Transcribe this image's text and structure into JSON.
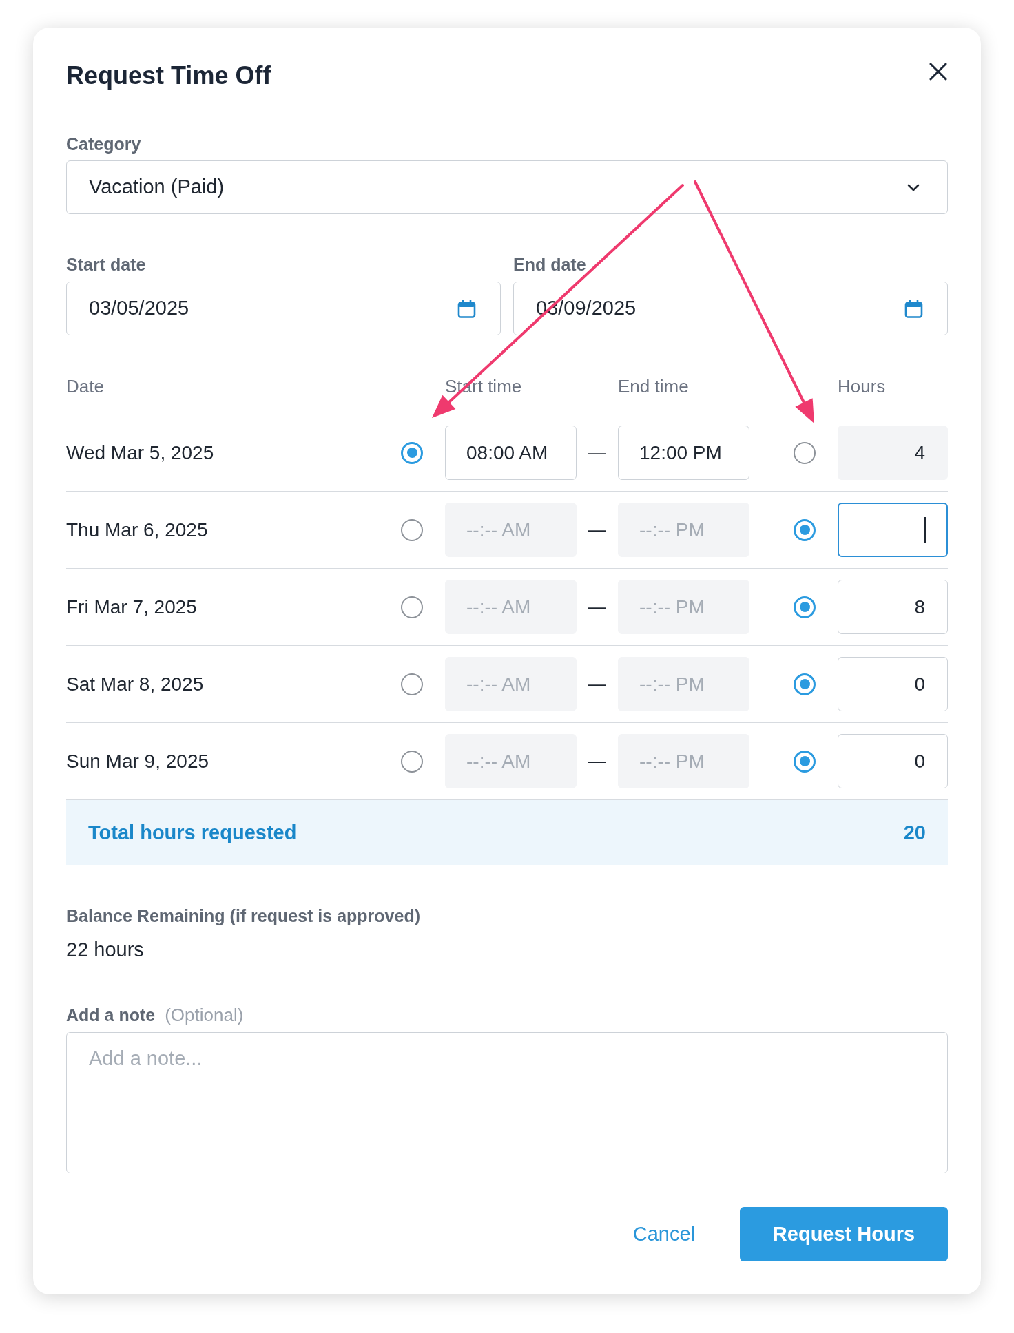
{
  "dialog": {
    "title": "Request Time Off"
  },
  "category": {
    "label": "Category",
    "value": "Vacation (Paid)"
  },
  "start_date": {
    "label": "Start date",
    "value": "03/05/2025"
  },
  "end_date": {
    "label": "End date",
    "value": "03/09/2025"
  },
  "table": {
    "columns": [
      "Date",
      "Start time",
      "End time",
      "Hours"
    ],
    "rows": [
      {
        "date": "Wed Mar 5, 2025",
        "time_option": {
          "selected": true
        },
        "start_time": {
          "value": "08:00 AM",
          "disabled": false
        },
        "separator": "—",
        "end_time": {
          "value": "12:00 PM",
          "disabled": false
        },
        "hours_option": {
          "selected": false
        },
        "hours": {
          "value": "4",
          "disabled": true,
          "focused": false
        }
      },
      {
        "date": "Thu Mar 6, 2025",
        "time_option": {
          "selected": false
        },
        "start_time": {
          "placeholder": "--:-- AM",
          "disabled": true
        },
        "separator": "—",
        "end_time": {
          "placeholder": "--:-- PM",
          "disabled": true
        },
        "hours_option": {
          "selected": true
        },
        "hours": {
          "disabled": false,
          "focused": true
        }
      },
      {
        "date": "Fri Mar 7, 2025",
        "time_option": {
          "selected": false
        },
        "start_time": {
          "placeholder": "--:-- AM",
          "disabled": true
        },
        "separator": "—",
        "end_time": {
          "placeholder": "--:-- PM",
          "disabled": true
        },
        "hours_option": {
          "selected": true
        },
        "hours": {
          "value": "8",
          "disabled": false,
          "focused": false
        }
      },
      {
        "date": "Sat Mar 8, 2025",
        "time_option": {
          "selected": false
        },
        "start_time": {
          "placeholder": "--:-- AM",
          "disabled": true
        },
        "separator": "—",
        "end_time": {
          "placeholder": "--:-- PM",
          "disabled": true
        },
        "hours_option": {
          "selected": true
        },
        "hours": {
          "value": "0",
          "disabled": false,
          "focused": false
        }
      },
      {
        "date": "Sun Mar 9, 2025",
        "time_option": {
          "selected": false
        },
        "start_time": {
          "placeholder": "--:-- AM",
          "disabled": true
        },
        "separator": "—",
        "end_time": {
          "placeholder": "--:-- PM",
          "disabled": true
        },
        "hours_option": {
          "selected": true
        },
        "hours": {
          "value": "0",
          "disabled": false,
          "focused": false
        }
      }
    ]
  },
  "total": {
    "label": "Total hours requested",
    "value": "20"
  },
  "balance": {
    "label": "Balance Remaining (if request is approved)",
    "value": "22 hours"
  },
  "note": {
    "label": "Add a note",
    "hint": "(Optional)",
    "placeholder": "Add a note..."
  },
  "actions": [
    {
      "kind": "link",
      "label": "Cancel"
    },
    {
      "kind": "primary",
      "label": "Request Hours"
    }
  ],
  "annotations": [
    {
      "kind": "arrow"
    },
    {
      "kind": "arrow"
    }
  ]
}
